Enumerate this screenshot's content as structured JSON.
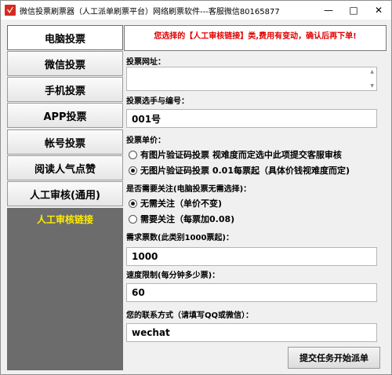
{
  "window": {
    "title": "微信投票刷票器（人工派单刷票平台）网络刷票软件---客服微信80165877"
  },
  "sidebar": {
    "items": [
      {
        "label": "电脑投票"
      },
      {
        "label": "微信投票"
      },
      {
        "label": "手机投票"
      },
      {
        "label": "APP投票"
      },
      {
        "label": "帐号投票"
      },
      {
        "label": "阅读人气点赞"
      },
      {
        "label": "人工审核(通用)"
      }
    ],
    "link_label": "人工审核链接"
  },
  "main": {
    "notice": "您选择的【人工审核链接】类,费用有变动，确认后再下单!",
    "url_label": "投票网址：",
    "url_value": "",
    "candidate_label": "投票选手与编号：",
    "candidate_value": "001号",
    "price_label": "投票单价：",
    "price_options": [
      {
        "label": "有图片验证码投票 视难度而定选中此项提交客服审核",
        "checked": false
      },
      {
        "label": "无图片验证码投票 0.01每票起（具体价钱视难度而定)",
        "checked": true
      }
    ],
    "follow_label": "是否需要关注(电脑投票无需选择)：",
    "follow_options": [
      {
        "label": "无需关注（单价不变)",
        "checked": true
      },
      {
        "label": "需要关注（每票加0.08)",
        "checked": false
      }
    ],
    "quantity_label": "需求票数(此类别1000票起)：",
    "quantity_value": "1000",
    "speed_label": "速度限制(每分钟多少票)：",
    "speed_value": "60",
    "contact_label": "您的联系方式（请填写QQ或微信）：",
    "contact_value": "wechat",
    "submit_label": "提交任务开始派单"
  }
}
